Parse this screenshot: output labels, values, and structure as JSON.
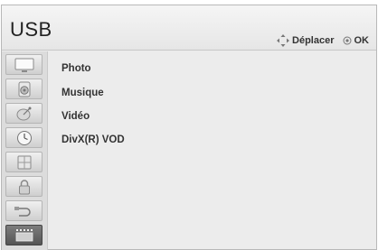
{
  "window": {
    "title": "USB"
  },
  "hint": {
    "move_label": "Déplacer",
    "ok_label": "OK",
    "move_icon": "dpad-arrows-icon",
    "ok_icon": "ok-button-icon"
  },
  "sidebar": {
    "items": [
      {
        "icon": "tv-picture-icon"
      },
      {
        "icon": "speaker-audio-icon"
      },
      {
        "icon": "satellite-channel-icon"
      },
      {
        "icon": "clock-time-icon"
      },
      {
        "icon": "option-globe-icon"
      },
      {
        "icon": "lock-icon"
      },
      {
        "icon": "input-plug-icon"
      },
      {
        "icon": "usb-media-icon",
        "active": true
      }
    ]
  },
  "menu": {
    "items": [
      {
        "label": "Photo"
      },
      {
        "label": "Musique"
      },
      {
        "label": "Vidéo"
      },
      {
        "label": "DivX(R) VOD"
      }
    ]
  },
  "colors": {
    "background": "#ececec",
    "header": "#e6e6e6",
    "sidebar": "#dcdcdc",
    "active_item": "#5a5a5a",
    "text": "#333333"
  }
}
